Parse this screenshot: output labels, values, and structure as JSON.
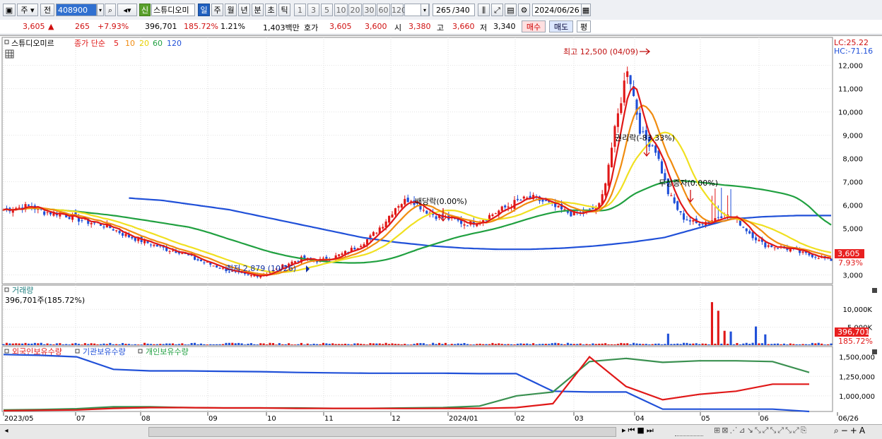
{
  "toolbar": {
    "type_label": "주",
    "prev_label": "전",
    "code": "408900",
    "new_badge": "신",
    "stock_name": "스튜디오미",
    "periods": [
      "일",
      "주",
      "월",
      "년",
      "분",
      "초",
      "틱"
    ],
    "numbers": [
      "1",
      "3",
      "5",
      "10",
      "20",
      "30",
      "60",
      "120"
    ],
    "count_display": "265",
    "count_total": "/340",
    "date": "2024/06/26"
  },
  "quote": {
    "price": "3,605",
    "arrow": "▲",
    "change": "265",
    "change_pct": "+7.93%",
    "volume": "396,701",
    "volume_ratio": "185.72%",
    "turnover": "1.21%",
    "amount": "1,403백만",
    "hoga_label": "호가",
    "hoga_sell": "3,605",
    "hoga_buy": "3,600",
    "open_label": "시",
    "open": "3,380",
    "high_label": "고",
    "high": "3,660",
    "low_label": "저",
    "low": "3,340",
    "buy_btn": "매수",
    "sell_btn": "매도",
    "eval_btn": "평"
  },
  "price_panel": {
    "title": "스튜디오미르",
    "ma_label": "종가 단순",
    "ma_periods": [
      "5",
      "10",
      "20",
      "60",
      "120"
    ],
    "ma_colors": {
      "5": "#e01818",
      "10": "#f08c10",
      "20": "#f0e020",
      "60": "#20a040",
      "120": "#2050d8"
    },
    "lc": "LC:25.22",
    "hc": "HC:-71.16",
    "high_annotation": "최고 12,500 (04/09)",
    "low_annotation": "최저 2,879 (10/26)",
    "dividend_annotation": "배당락(0.00%)",
    "rights_annotation": "권리락(-83.33%)",
    "bonus_annotation": "무상증자(0.00%)",
    "price_tag": "3,605",
    "pct_tag": "7.93%"
  },
  "volume_panel": {
    "title": "거래량",
    "value_label": "396,701주(185.72%)",
    "tag_value": "396,701",
    "tag_pct": "185.72%"
  },
  "holdings_panel": {
    "foreign": "외국인보유수량",
    "institution": "기관보유수량",
    "individual": "개인보유수량"
  },
  "x_axis": [
    "2023/05",
    "07",
    "08",
    "09",
    "10",
    "11",
    "12",
    "2024/01",
    "02",
    "03",
    "04",
    "05",
    "06",
    "06/26"
  ],
  "chart_data": [
    {
      "type": "line",
      "y_ticks": [
        3000,
        4000,
        5000,
        6000,
        7000,
        8000,
        9000,
        10000,
        11000,
        12000
      ],
      "ylim": [
        2650,
        12900
      ],
      "x_count": 265,
      "close_approx": [
        5800,
        5900,
        5950,
        5700,
        5650,
        5500,
        5300,
        5200,
        5000,
        4700,
        4500,
        4300,
        4100,
        4000,
        3700,
        3500,
        3300,
        3100,
        2950,
        3000,
        3200,
        3500,
        3700,
        3600,
        3700,
        3900,
        4200,
        4600,
        5200,
        6000,
        6300,
        5800,
        5500,
        5400,
        5200,
        5300,
        5600,
        5900,
        6200,
        6300,
        6100,
        5800,
        5600,
        5700,
        6000,
        9000,
        12000,
        9000,
        8500,
        6500,
        5500,
        5200,
        5300,
        5600,
        5400,
        4800,
        4300,
        4200,
        4100,
        3900,
        3800,
        3605
      ],
      "ma120_approx": [
        6300,
        6200,
        6000,
        5800,
        5500,
        5200,
        4900,
        4600,
        4400,
        4250,
        4150,
        4100,
        4100,
        4150,
        4250,
        4400,
        4600,
        5000,
        5400,
        5500,
        5550,
        5550
      ]
    },
    {
      "type": "bar",
      "y_ticks": [
        "10,000K",
        "5,000K"
      ],
      "notable_values_k": [
        3200,
        12000,
        9600,
        4000,
        3800,
        5200,
        3000
      ]
    },
    {
      "type": "line",
      "y_ticks": [
        "1,500,000",
        "1,250,000",
        "1,000,000"
      ]
    }
  ]
}
